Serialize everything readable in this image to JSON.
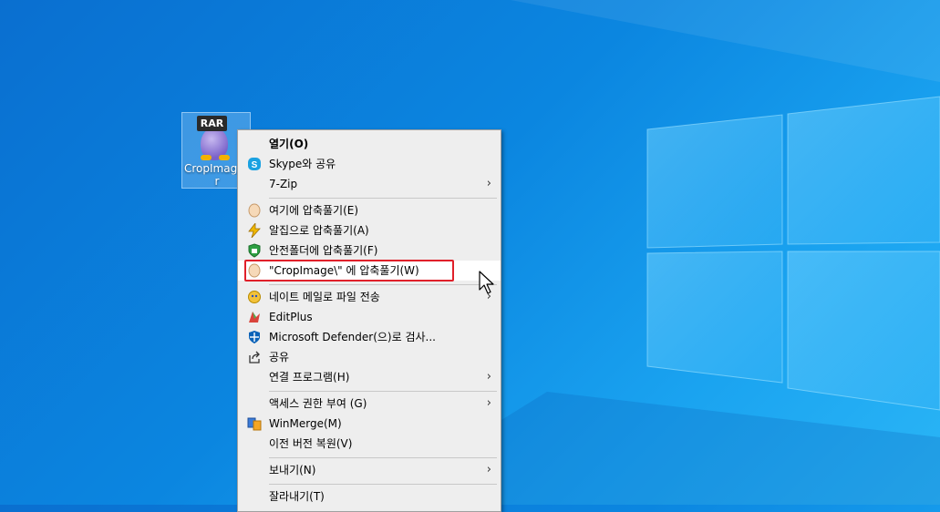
{
  "desktop": {
    "icon_badge": "RAR",
    "icon_label_line1": "CropImage",
    "icon_label_line2": "r"
  },
  "context_menu": {
    "items": [
      {
        "label": "열기(O)",
        "icon": "none",
        "bold": true
      },
      {
        "label": "Skype와 공유",
        "icon": "skype-icon"
      },
      {
        "label": "7-Zip",
        "icon": "none",
        "submenu": true
      },
      {
        "label": "여기에 압축풀기(E)",
        "icon": "egg-icon"
      },
      {
        "label": "알집으로 압축풀기(A)",
        "icon": "alzip-icon"
      },
      {
        "label": "안전폴더에 압축풀기(F)",
        "icon": "shield-folder-icon"
      },
      {
        "label": "\"CropImage\\\" 에 압축풀기(W)",
        "icon": "egg-icon"
      },
      {
        "label": "네이트 메일로 파일 전송",
        "icon": "nate-icon",
        "submenu": true
      },
      {
        "label": "EditPlus",
        "icon": "editplus-icon"
      },
      {
        "label": "Microsoft Defender(으)로 검사...",
        "icon": "defender-icon"
      },
      {
        "label": "공유",
        "icon": "share-icon"
      },
      {
        "label": "연결 프로그램(H)",
        "icon": "none",
        "submenu": true
      },
      {
        "label": "액세스 권한 부여 (G)",
        "icon": "none",
        "submenu": true
      },
      {
        "label": "WinMerge(M)",
        "icon": "winmerge-icon"
      },
      {
        "label": "이전 버전 복원(V)",
        "icon": "none"
      },
      {
        "label": "보내기(N)",
        "icon": "none",
        "submenu": true
      },
      {
        "label": "잘라내기(T)",
        "icon": "none"
      }
    ],
    "submenu_arrow": "›"
  },
  "colors": {
    "highlight_border": "#e0202a",
    "menu_background": "#eeeeee"
  }
}
